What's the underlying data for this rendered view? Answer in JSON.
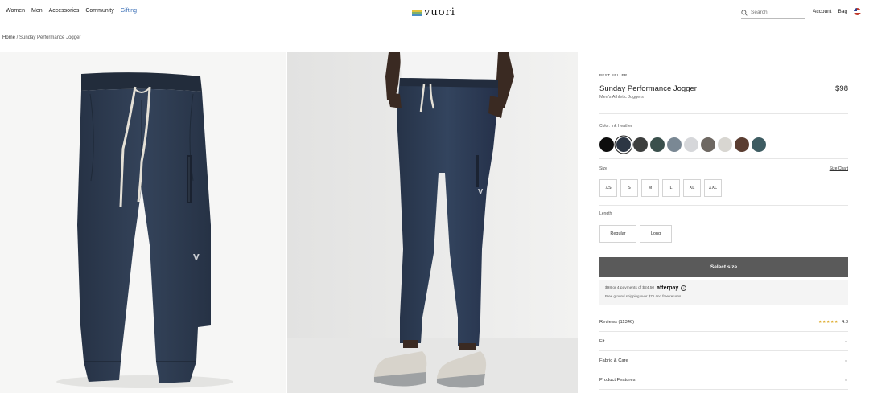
{
  "header": {
    "nav_left": [
      "Women",
      "Men",
      "Accessories",
      "Community",
      "Gifting"
    ],
    "logo_text": "vuori",
    "search_placeholder": "Search",
    "account": "Account",
    "bag": "Bag"
  },
  "breadcrumb": {
    "home": "Home",
    "separator": " / ",
    "current": "Sunday Performance Jogger"
  },
  "product": {
    "badge": "BEST SELLER",
    "title": "Sunday Performance Jogger",
    "price": "$98",
    "subtitle": "Men's Athletic Joggers",
    "color_label": "Color: Ink Heather",
    "swatches": [
      "#0d0d0d",
      "#2c3644",
      "#3d3f3e",
      "#3a4f4c",
      "#7a8894",
      "#d6d7da",
      "#6e6862",
      "#d8d6d1",
      "#5a3d31",
      "#3e5c62"
    ],
    "size_label": "Size",
    "size_chart": "Size Chart",
    "sizes": [
      "XS",
      "S",
      "M",
      "L",
      "XL",
      "XXL"
    ],
    "length_label": "Length",
    "lengths": [
      "Regular",
      "Long"
    ],
    "cta": "Select size",
    "afterpay_text": "$98 or 4 payments of $24.50",
    "afterpay_brand": "afterpay",
    "shipping": "Free ground shipping over $75 and free returns",
    "reviews_label": "Reviews (11346)",
    "rating": "4.8",
    "accordions": [
      "Fit",
      "Fabric & Care",
      "Product Features"
    ]
  },
  "colors": {
    "accent_link": "#3b6fb6",
    "cta_bg": "#5a5a5a",
    "pants": "#2f3d50",
    "star": "#e0b13a"
  }
}
